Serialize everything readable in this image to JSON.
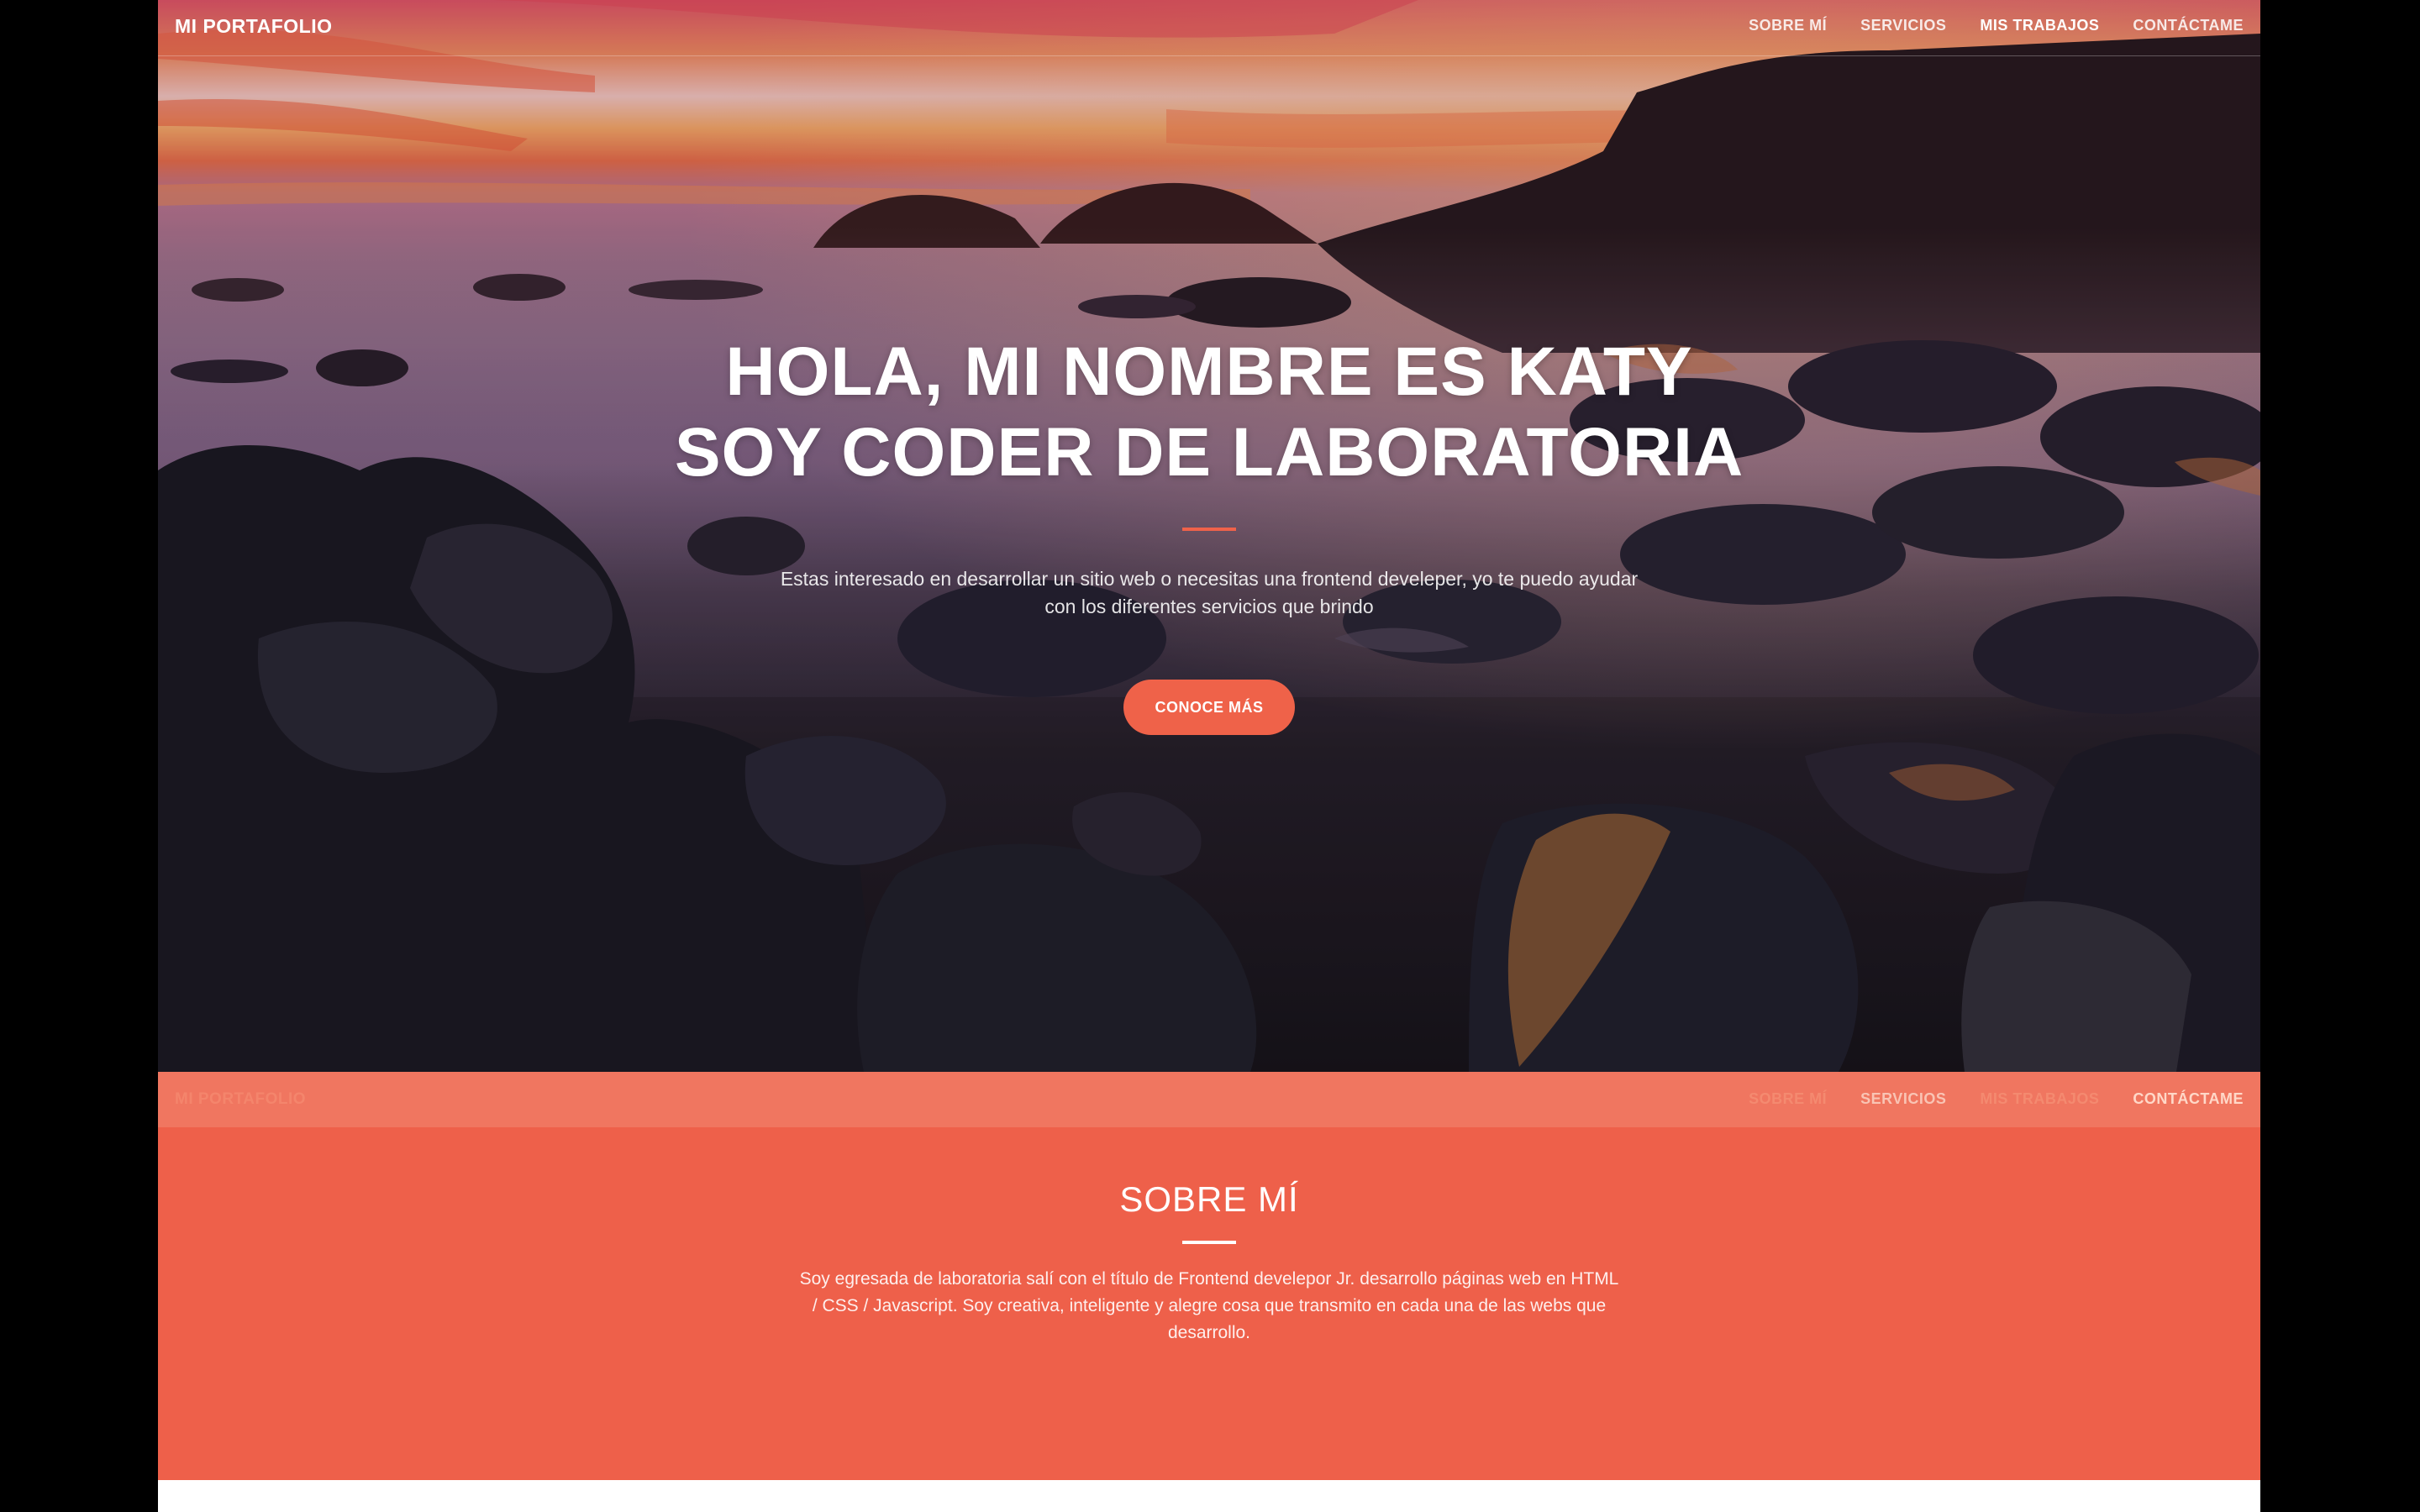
{
  "site": {
    "brand": "MI PORTAFOLIO",
    "nav": [
      "SOBRE MÍ",
      "SERVICIOS",
      "MIS TRABAJOS",
      "CONTÁCTAME"
    ]
  },
  "hero": {
    "title_line1": "HOLA, MI NOMBRE ES KATY",
    "title_line2": "SOY CODER DE LABORATORIA",
    "lead_line1": "Estas interesado en desarrollar un sitio web o necesitas una frontend develeper, yo te puedo ayudar",
    "lead_line2": "con los diferentes servicios que brindo",
    "cta": "CONOCE MÁS"
  },
  "about": {
    "title": "SOBRE MÍ",
    "text_line1": "Soy egresada de laboratoria salí con el título de Frontend develepor Jr. desarrollo páginas web en HTML",
    "text_line2": "/ CSS / Javascript. Soy creativa, inteligente y alegre cosa que transmito en cada una de las webs que",
    "text_line3": "desarrollo."
  },
  "colors": {
    "accent": "#ef6249",
    "about_bg": "#ee604a",
    "sticky_nav_bg": "#f07660",
    "outer_bg": "#000000"
  }
}
